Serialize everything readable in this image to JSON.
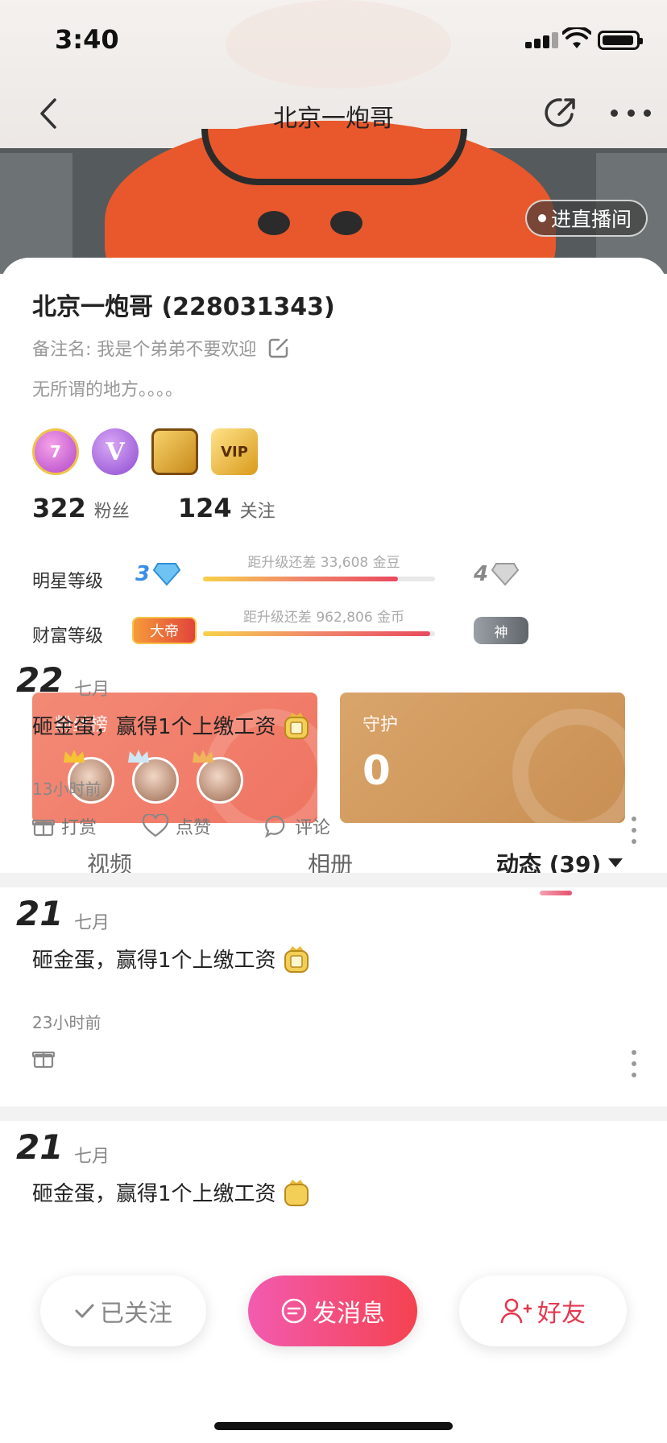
{
  "status_bar": {
    "time": "3:40"
  },
  "nav": {
    "title": "北京一炮哥",
    "live_label": "进直播间"
  },
  "profile": {
    "name_with_id": "北京一炮哥 (228031343)",
    "remark": "备注名: 我是个弟弟不要欢迎",
    "bio": "无所谓的地方。。。。",
    "badges": [
      "7",
      "V",
      "",
      "VIP"
    ],
    "fans_count": "322",
    "fans_label": "粉丝",
    "following_count": "124",
    "following_label": "关注"
  },
  "levels": {
    "star": {
      "label": "明星等级",
      "current": "3",
      "next": "4",
      "hint": "距升级还差 33,608 金豆",
      "progress": 0.84
    },
    "wealth": {
      "label": "财富等级",
      "current_tag": "大帝",
      "next_tag": "神",
      "hint": "距升级还差 962,806 金币",
      "progress": 0.98
    }
  },
  "rank": {
    "fans_title": "粉丝榜",
    "guard_title": "守护",
    "guard_value": "0"
  },
  "tabs": {
    "video": "视频",
    "album": "相册",
    "feed": "动态 (39)"
  },
  "posts": [
    {
      "day": "22",
      "month": "七月",
      "text": "砸金蛋，赢得1个上缴工资",
      "time": "13小时前"
    },
    {
      "day": "21",
      "month": "七月",
      "text": "砸金蛋，赢得1个上缴工资",
      "time": "23小时前"
    },
    {
      "day": "21",
      "month": "七月",
      "text": "砸金蛋，赢得1个上缴工资",
      "time": ""
    }
  ],
  "actions": {
    "gift": "打赏",
    "like": "点赞",
    "comment": "评论"
  },
  "bottom": {
    "followed": "已关注",
    "message": "发消息",
    "friend": "好友"
  },
  "colors": {
    "accent": "#e4384f",
    "fans_card": "#f07462",
    "guard_card": "#c98f54"
  }
}
